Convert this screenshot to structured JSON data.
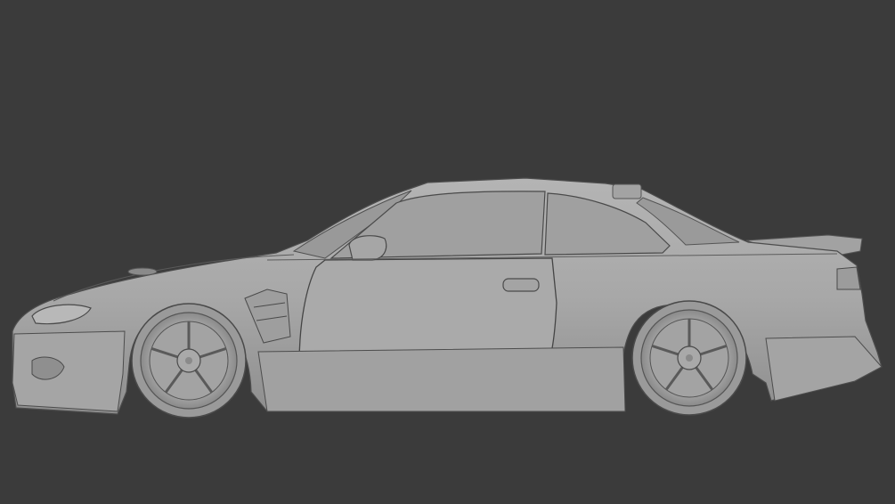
{
  "scene": {
    "background_color": "#3b3b3b",
    "model_base_color": "#a9a9a9",
    "model_shadow_color": "#8c8c8c",
    "model_highlight_color": "#bdbdbd",
    "outline_color": "#4a4a4a",
    "subject": "car-model-side-view"
  }
}
